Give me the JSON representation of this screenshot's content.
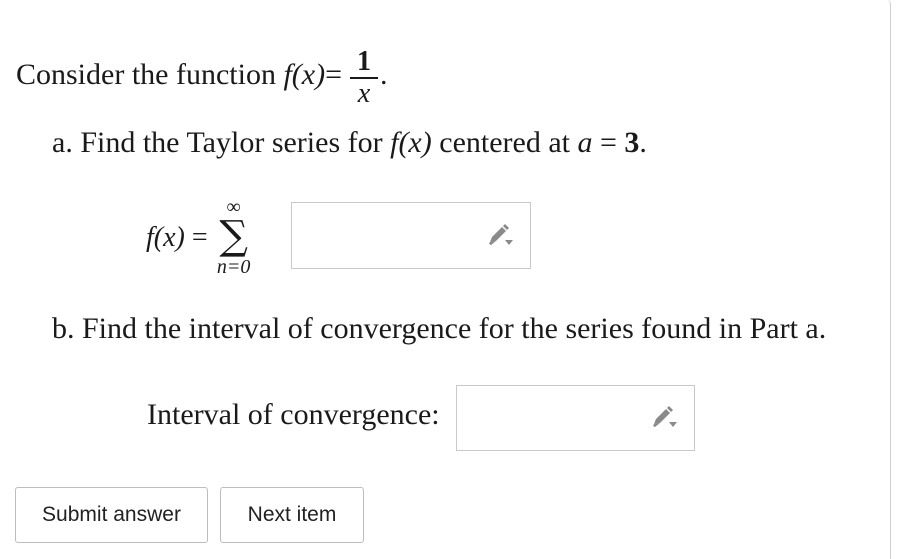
{
  "question": {
    "intro_text": "Consider the function ",
    "function_lhs": "f(x)",
    "equals": " = ",
    "numerator": "1",
    "denominator": "x",
    "end_period": "."
  },
  "part_a": {
    "label": "a. Find the Taylor series for ",
    "func": "f(x)",
    "middle": " centered at ",
    "center_var": "a",
    "center_eq": " = ",
    "center_val": "3",
    "period": ".",
    "series_lhs": "f(x)",
    "series_eq": " = ",
    "sum_upper": "∞",
    "sum_symbol": "∑",
    "sum_lower": "n=0",
    "answer_value": ""
  },
  "part_b": {
    "label": "b. Find the interval of convergence for the series found in Part a.",
    "interval_label": "Interval of convergence:",
    "answer_value": ""
  },
  "buttons": {
    "submit": "Submit answer",
    "next": "Next item"
  },
  "icons": {
    "answer_edit": "pencil-dropdown-icon"
  },
  "colors": {
    "border": "#c9c9c9",
    "icon": "#8a8a8a"
  }
}
